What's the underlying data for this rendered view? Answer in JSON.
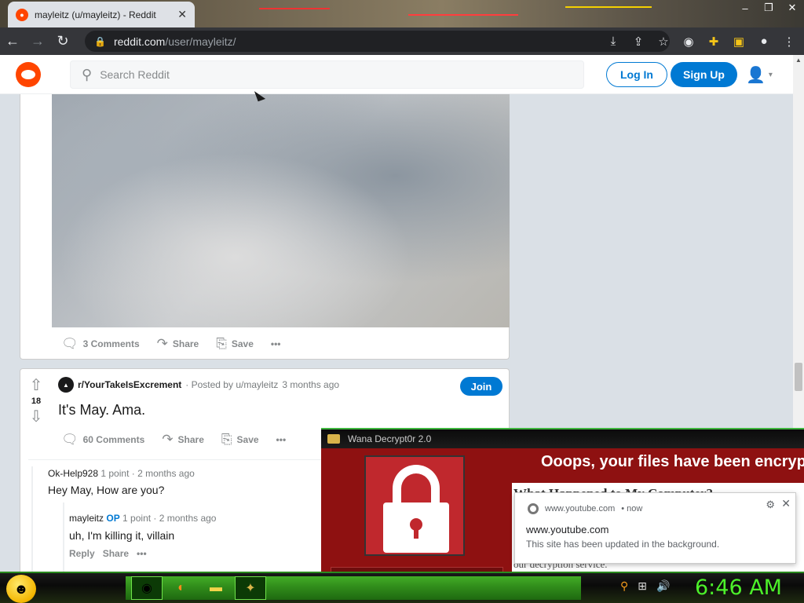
{
  "browser": {
    "tab_title": "mayleitz (u/mayleitz) - Reddit",
    "url_host": "reddit.com",
    "url_path": "/user/mayleitz/",
    "window_controls": [
      "minimize-icon",
      "restore-icon",
      "close-icon"
    ]
  },
  "reddit_header": {
    "search_placeholder": "Search Reddit",
    "login_label": "Log In",
    "signup_label": "Sign Up"
  },
  "post1": {
    "comments_label": "3 Comments",
    "share_label": "Share",
    "save_label": "Save",
    "more_label": "•••"
  },
  "post2": {
    "vote_count": "18",
    "subreddit": "r/YourTakeIsExcrement",
    "posted_by": "· Posted by u/mayleitz",
    "time": "3 months ago",
    "join_label": "Join",
    "title": "It's May. Ama.",
    "comments_label": "60 Comments",
    "share_label": "Share",
    "save_label": "Save",
    "more_label": "•••"
  },
  "comments": [
    {
      "author": "Ok-Help928",
      "points": "1 point",
      "time": "· 2 months ago",
      "text": "Hey May, How are you?"
    },
    {
      "author": "mayleitz",
      "badge": "OP",
      "points": "1 point",
      "time": "· 2 months ago",
      "text": "uh, I'm killing it, villain",
      "reply_label": "Reply",
      "share_label": "Share",
      "more_label": "•••"
    }
  ],
  "wana": {
    "title": "Wana Decrypt0r 2.0",
    "headline": "Ooops, your files have been encryp",
    "panel_heading": "What Happened to My Computer?",
    "panel_footer": "our decryption service."
  },
  "notification": {
    "source": "www.youtube.com",
    "time": "• now",
    "title": "www.youtube.com",
    "body": "This site has been updated in the background."
  },
  "taskbar": {
    "clock": "6:46 AM",
    "accent": "#4cf02a"
  },
  "colors": {
    "reddit_orange": "#ff4500",
    "reddit_blue": "#0079d3",
    "wana_red": "#8e1111"
  }
}
